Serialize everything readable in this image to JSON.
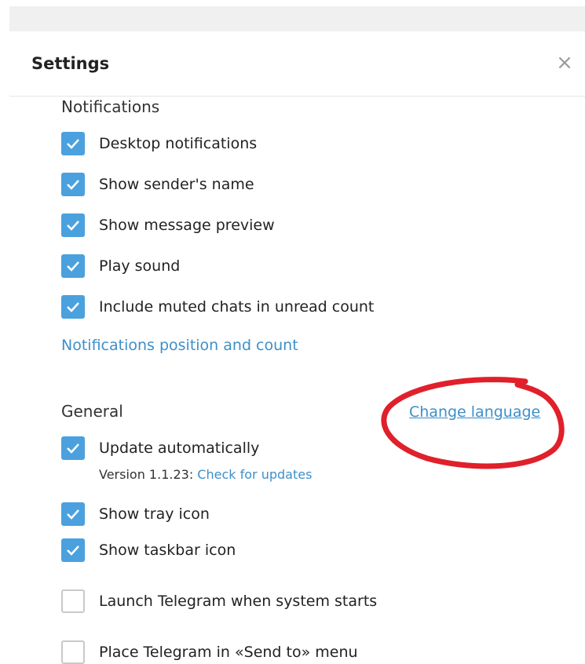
{
  "header": {
    "title": "Settings",
    "close_icon": "close-icon",
    "close_glyph": "×"
  },
  "notifications": {
    "title": "Notifications",
    "items": [
      {
        "label": "Desktop notifications",
        "checked": true
      },
      {
        "label": "Show sender's name",
        "checked": true
      },
      {
        "label": "Show message preview",
        "checked": true
      },
      {
        "label": "Play sound",
        "checked": true
      },
      {
        "label": "Include muted chats in unread count",
        "checked": true
      }
    ],
    "position_link": "Notifications position and count"
  },
  "general": {
    "title": "General",
    "change_language": "Change language",
    "update": {
      "label": "Update automatically",
      "checked": true
    },
    "version_text": "Version 1.1.23:",
    "check_updates": "Check for updates",
    "items": [
      {
        "label": "Show tray icon",
        "checked": true
      },
      {
        "label": "Show taskbar icon",
        "checked": true
      },
      {
        "label": "Launch Telegram when system starts",
        "checked": false
      },
      {
        "label": "Place Telegram in «Send to» menu",
        "checked": false
      }
    ]
  },
  "colors": {
    "accent": "#4aa1de",
    "link": "#3d8fc9",
    "annotation": "#e0202a"
  }
}
